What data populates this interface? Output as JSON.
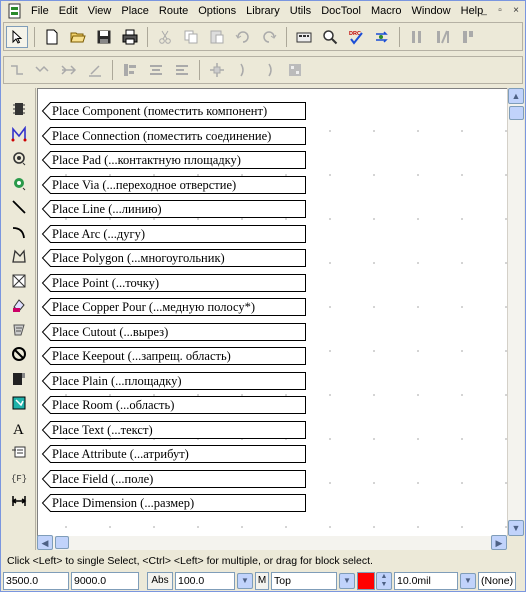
{
  "menu": [
    "File",
    "Edit",
    "View",
    "Place",
    "Route",
    "Options",
    "Library",
    "Utils",
    "DocTool",
    "Macro",
    "Window",
    "Help"
  ],
  "window_controls": [
    "_",
    "▫",
    "×"
  ],
  "toolbar1": [
    "select",
    "new",
    "open",
    "save",
    "print",
    "cut",
    "copy",
    "paste",
    "undo",
    "redo",
    "display",
    "zoom",
    "drc",
    "routing",
    "split-1",
    "split-2",
    "split-3"
  ],
  "toolbar1_drc_label": "DRC",
  "tools": [
    {
      "icon": "place-component-icon",
      "label": "Place Component (поместить компонент)"
    },
    {
      "icon": "place-connection-icon",
      "label": "Place Connection (поместить соединение)"
    },
    {
      "icon": "place-pad-icon",
      "label": "Place Pad (...контактную площадку)"
    },
    {
      "icon": "place-via-icon",
      "label": "Place Via (...переходное отверстие)"
    },
    {
      "icon": "place-line-icon",
      "label": "Place Line (...линию)"
    },
    {
      "icon": "place-arc-icon",
      "label": "Place Arc (...дугу)"
    },
    {
      "icon": "place-polygon-icon",
      "label": "Place Polygon (...многоугольник)"
    },
    {
      "icon": "place-point-icon",
      "label": "Place Point (...точку)"
    },
    {
      "icon": "place-copper-pour-icon",
      "label": "Place Copper Pour (...медную полосу*)"
    },
    {
      "icon": "place-cutout-icon",
      "label": "Place Cutout (...вырез)"
    },
    {
      "icon": "place-keepout-icon",
      "label": "Place Keepout (...запрещ. область)"
    },
    {
      "icon": "place-plain-icon",
      "label": "Place Plain (...площадку)"
    },
    {
      "icon": "place-room-icon",
      "label": "Place Room (...область)"
    },
    {
      "icon": "place-text-icon",
      "label": "Place Text (...текст)"
    },
    {
      "icon": "place-attribute-icon",
      "label": "Place Attribute (...атрибут)"
    },
    {
      "icon": "place-field-icon",
      "label": "Place Field (...поле)"
    },
    {
      "icon": "place-dimension-icon",
      "label": "Place Dimension (...размер)"
    }
  ],
  "tool_glyphs": {
    "text": "A",
    "field": "{F}"
  },
  "status": {
    "message": "Click <Left> to single Select, <Ctrl> <Left> for multiple, or drag for block select.",
    "x": "3500.0",
    "y": "9000.0",
    "abs": "Abs",
    "zoom": "100.0",
    "m": "M",
    "layer": "Top",
    "layer_color": "#ff0000",
    "width": "10.0mil",
    "style": "(None)"
  }
}
